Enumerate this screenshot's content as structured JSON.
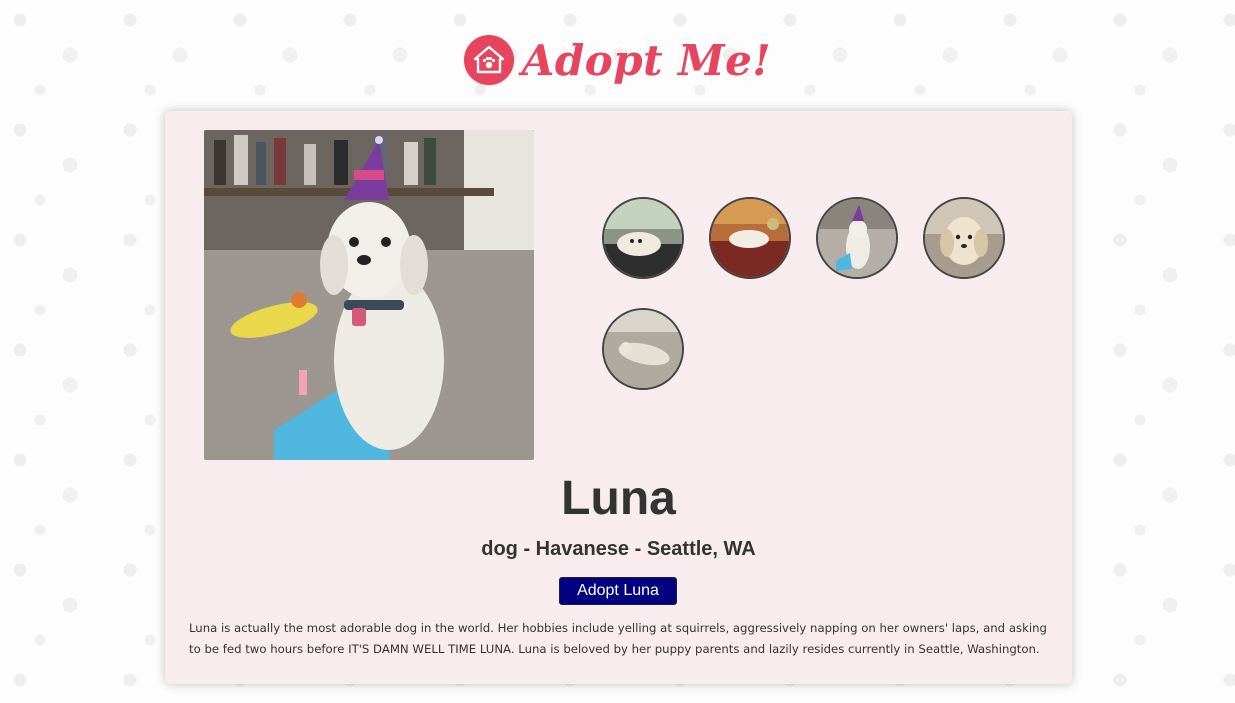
{
  "header": {
    "brand_text": "Adopt Me!",
    "brand_color": "#e7445e"
  },
  "pet": {
    "name": "Luna",
    "meta": "dog - Havanese - Seattle, WA",
    "adopt_label": "Adopt Luna",
    "description": "Luna is actually the most adorable dog in the world. Her hobbies include yelling at squirrels, aggressively napping on her owners' laps, and asking to be fed two hours before IT'S DAMN WELL TIME LUNA. Luna is beloved by her puppy parents and lazily resides currently in Seattle, Washington.",
    "hero_image": "photo-of-white-dog-with-party-hat",
    "thumbnails": [
      "dog-lying-on-couch-photo",
      "dog-on-red-sofa-photo",
      "dog-with-party-hat-photo",
      "dog-face-closeup-photo",
      "dog-sleeping-on-floor-photo"
    ]
  },
  "colors": {
    "card_background": "#f9ecef",
    "button_background": "#000080"
  }
}
